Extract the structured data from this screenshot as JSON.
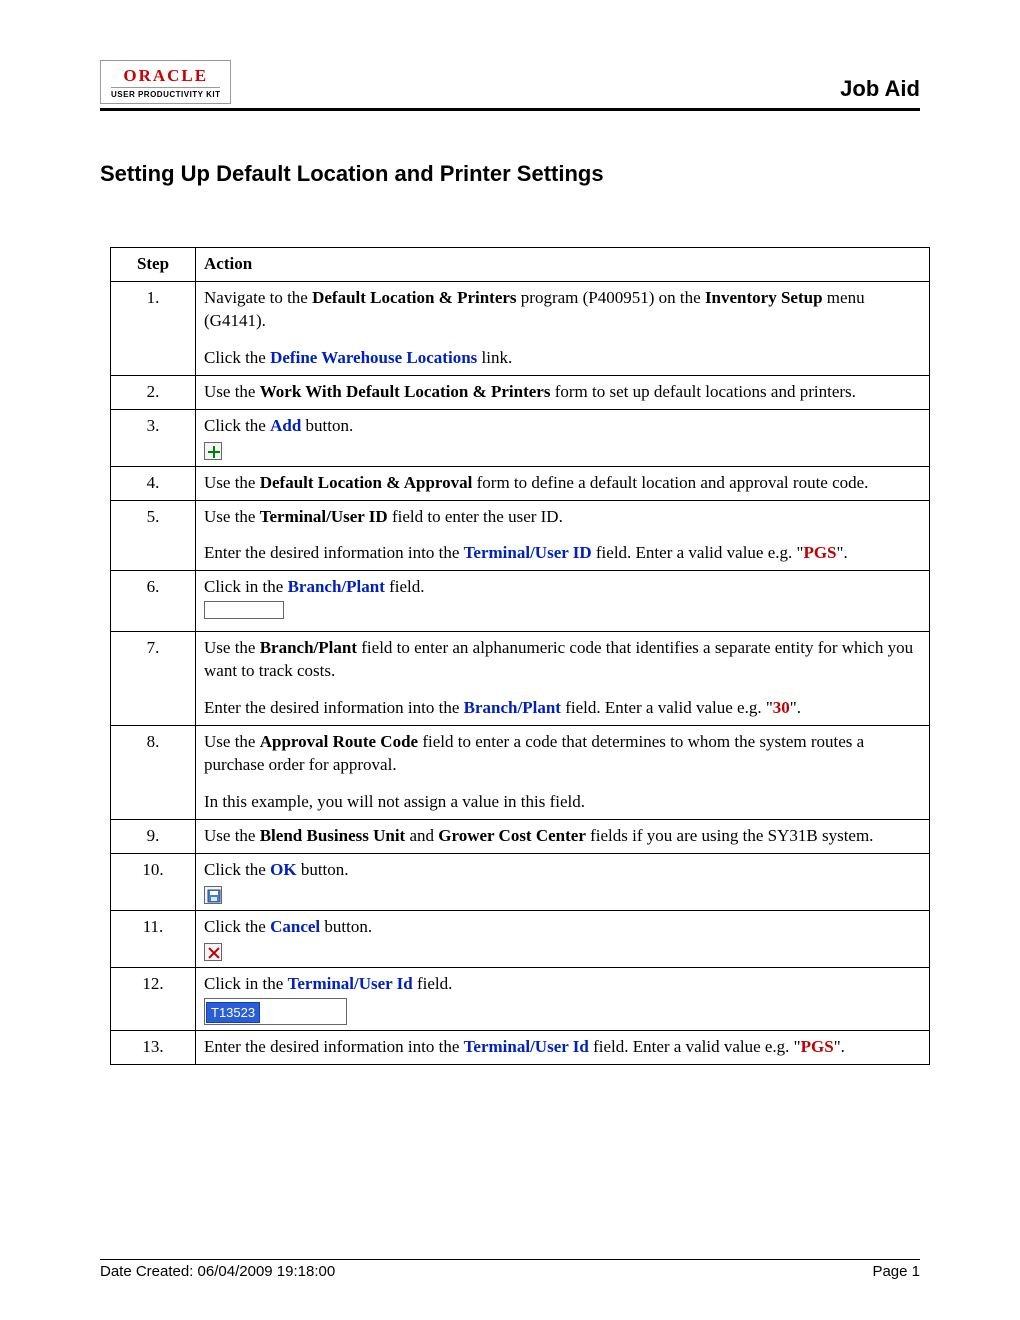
{
  "header": {
    "logo_top": "ORACLE",
    "logo_bottom": "USER PRODUCTIVITY KIT",
    "right": "Job Aid"
  },
  "title": "Setting Up Default Location and Printer Settings",
  "columns": {
    "step": "Step",
    "action": "Action"
  },
  "steps": {
    "r1": {
      "n": "1.",
      "t1a": "Navigate to the ",
      "t1b": "Default Location & Printers",
      "t1c": " program (P400951) on the ",
      "t1d": "Inventory Setup",
      "t1e": " menu (G4141).",
      "t2a": "Click the ",
      "t2b": "Define Warehouse Locations",
      "t2c": " link."
    },
    "r2": {
      "n": "2.",
      "t1a": "Use the ",
      "t1b": "Work With Default Location & Printers",
      "t1c": " form to set up default locations and printers."
    },
    "r3": {
      "n": "3.",
      "t1a": "Click the ",
      "t1b": "Add",
      "t1c": " button."
    },
    "r4": {
      "n": "4.",
      "t1a": "Use the ",
      "t1b": "Default Location & Approval",
      "t1c": " form to define a default location and approval route code."
    },
    "r5": {
      "n": "5.",
      "t1a": "Use the ",
      "t1b": "Terminal/User ID",
      "t1c": " field to enter the user ID.",
      "t2a": "Enter the desired information into the ",
      "t2b": "Terminal/User ID",
      "t2c": " field. Enter a valid value e.g. \"",
      "t2d": "PGS",
      "t2e": "\"."
    },
    "r6": {
      "n": "6.",
      "t1a": "Click in the ",
      "t1b": "Branch/Plant",
      "t1c": " field."
    },
    "r7": {
      "n": "7.",
      "t1a": "Use the ",
      "t1b": "Branch/Plant",
      "t1c": " field to enter an alphanumeric code that identifies a separate entity for which you want to track costs.",
      "t2a": "Enter the desired information into the ",
      "t2b": "Branch/Plant",
      "t2c": " field. Enter a valid value e.g. \"",
      "t2d": "30",
      "t2e": "\"."
    },
    "r8": {
      "n": "8.",
      "t1a": "Use the ",
      "t1b": "Approval Route Code",
      "t1c": " field to enter a code that determines to whom the system routes a purchase order for approval.",
      "t2": "In this example, you will not assign a value in this field."
    },
    "r9": {
      "n": "9.",
      "t1a": "Use the ",
      "t1b": "Blend Business Unit",
      "t1c": " and ",
      "t1d": "Grower Cost Center",
      "t1e": " fields if you are using the SY31B system."
    },
    "r10": {
      "n": "10.",
      "t1a": "Click the ",
      "t1b": "OK",
      "t1c": " button."
    },
    "r11": {
      "n": "11.",
      "t1a": "Click the ",
      "t1b": "Cancel",
      "t1c": " button."
    },
    "r12": {
      "n": "12.",
      "t1a": "Click in the ",
      "t1b": "Terminal/User Id",
      "t1c": " field.",
      "box": "T13523"
    },
    "r13": {
      "n": "13.",
      "t1a": "Enter the desired information into the ",
      "t1b": "Terminal/User Id",
      "t1c": " field. Enter a valid value e.g. \"",
      "t1d": "PGS",
      "t1e": "\"."
    }
  },
  "footer": {
    "left": "Date Created: 06/04/2009 19:18:00",
    "right": "Page 1"
  }
}
